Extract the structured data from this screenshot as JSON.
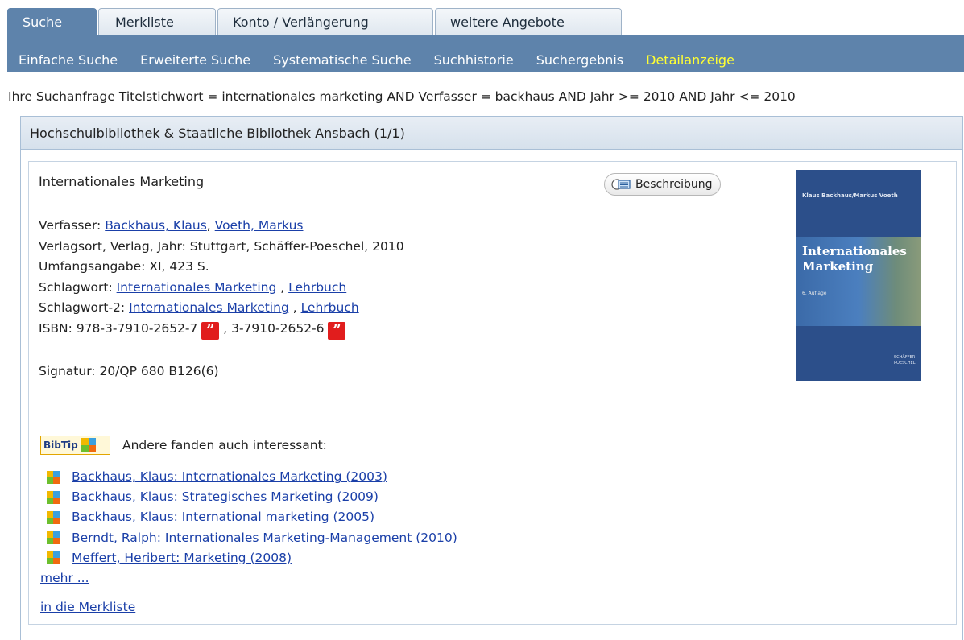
{
  "tabs": [
    {
      "label": "Suche",
      "active": true
    },
    {
      "label": "Merkliste",
      "active": false
    },
    {
      "label": "Konto / Verlängerung",
      "active": false
    },
    {
      "label": "weitere Angebote",
      "active": false
    }
  ],
  "subnav": [
    {
      "label": "Einfache Suche",
      "current": false
    },
    {
      "label": "Erweiterte Suche",
      "current": false
    },
    {
      "label": "Systematische Suche",
      "current": false
    },
    {
      "label": "Suchhistorie",
      "current": false
    },
    {
      "label": "Suchergebnis",
      "current": false
    },
    {
      "label": "Detailanzeige",
      "current": true
    }
  ],
  "query": {
    "label": "Ihre Suchanfrage",
    "text": "Titelstichwort = internationales marketing AND Verfasser = backhaus AND Jahr >= 2010 AND Jahr <= 2010"
  },
  "panel": {
    "title": "Hochschulbibliothek & Staatliche Bibliothek Ansbach (1/1)"
  },
  "record": {
    "title": "Internationales Marketing",
    "description_button": "Beschreibung",
    "fields": {
      "verfasser_label": "Verfasser:",
      "author1": "Backhaus, Klaus",
      "sep": ",",
      "author2": "Voeth, Markus",
      "verlag_label": "Verlagsort, Verlag, Jahr:",
      "verlag_value": "Stuttgart, Schäffer-Poeschel, 2010",
      "umfang_label": "Umfangsangabe:",
      "umfang_value": "XI, 423 S.",
      "schlag_label": "Schlagwort:",
      "schlag1": "Internationales Marketing",
      "schlag2": "Lehrbuch",
      "schlag2_label": "Schlagwort-2:",
      "schlag2_1": "Internationales Marketing",
      "schlag2_2": "Lehrbuch",
      "list_sep": " , ",
      "isbn_label": "ISBN:",
      "isbn1": "978-3-7910-2652-7",
      "isbn2": "3-7910-2652-6",
      "quote_glyph": "”"
    },
    "signatur": "Signatur: 20/QP 680 B126(6)",
    "cover": {
      "authors": "Klaus Backhaus/Markus Voeth",
      "title_line1": "Internationales",
      "title_line2": "Marketing",
      "edition": "6. Auflage",
      "publisher_line1": "SCHÄFFER",
      "publisher_line2": "POESCHEL"
    }
  },
  "bibtip": {
    "badge": "BibTip",
    "heading": "Andere fanden auch interessant:",
    "items": [
      "Backhaus, Klaus: Internationales Marketing (2003)",
      "Backhaus, Klaus: Strategisches Marketing (2009)",
      "Backhaus, Klaus: International marketing (2005)",
      "Berndt, Ralph: Internationales Marketing-Management (2010)",
      "Meffert, Heribert: Marketing (2008)"
    ],
    "more": "mehr ..."
  },
  "merkliste_link": "in die Merkliste"
}
